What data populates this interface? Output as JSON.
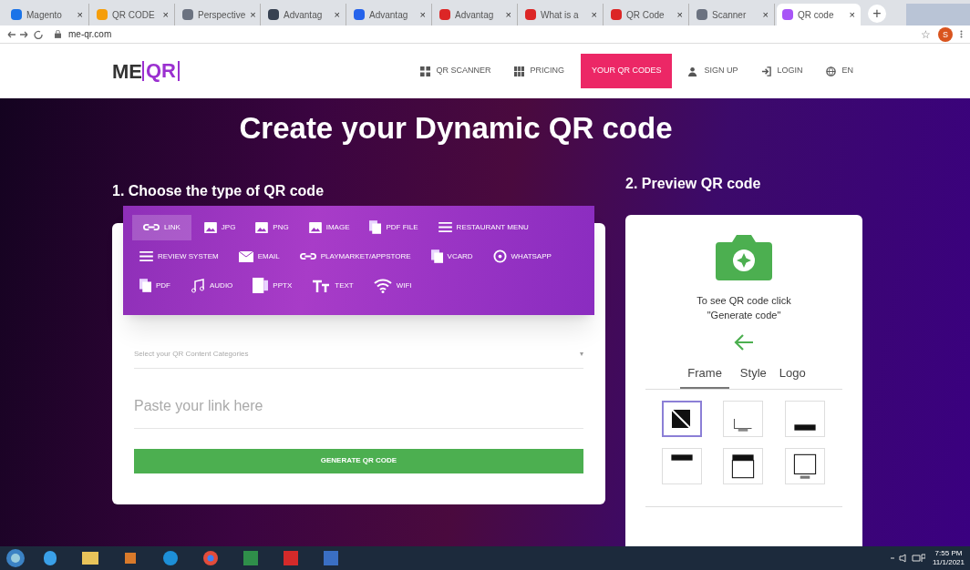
{
  "browser": {
    "tabs": [
      {
        "title": "Magento",
        "color": "#1a73e8",
        "selected": false
      },
      {
        "title": "QR CODE",
        "color": "#f59e0b",
        "selected": false
      },
      {
        "title": "Perspective",
        "color": "#6b7280",
        "selected": false
      },
      {
        "title": "Advantag",
        "color": "#374151",
        "selected": false
      },
      {
        "title": "Advantag",
        "color": "#2563eb",
        "selected": false
      },
      {
        "title": "Advantag",
        "color": "#dc2626",
        "selected": false
      },
      {
        "title": "What is a",
        "color": "#dc2626",
        "selected": false
      },
      {
        "title": "QR Code",
        "color": "#dc2626",
        "selected": false
      },
      {
        "title": "Scanner",
        "color": "#6b7280",
        "selected": false
      },
      {
        "title": "QR code",
        "color": "#a855f7",
        "selected": true
      }
    ],
    "new_tab": "+",
    "close": "×",
    "url": "me-qr.com",
    "bookmark": "☆",
    "profile": "S"
  },
  "site": {
    "logo_left": "ME",
    "logo_right": "QR",
    "nav": [
      {
        "label": "QR SCANNER",
        "kind": "grid",
        "selected": false
      },
      {
        "label": "PRICING",
        "kind": "table",
        "selected": false
      },
      {
        "label": "YOUR QR CODES",
        "kind": "plain",
        "selected": true
      },
      {
        "label": "SIGN UP",
        "kind": "user",
        "selected": false
      },
      {
        "label": "LOGIN",
        "kind": "login",
        "selected": false
      },
      {
        "label": "EN",
        "kind": "globe",
        "selected": false
      }
    ]
  },
  "title": "Create your Dynamic QR code",
  "left": {
    "heading": "1. Choose the type of QR code",
    "types": [
      {
        "label": "LINK",
        "kind": "link",
        "selected": true
      },
      {
        "label": "JPG",
        "kind": "image",
        "selected": false
      },
      {
        "label": "PNG",
        "kind": "image",
        "selected": false
      },
      {
        "label": "IMAGE",
        "kind": "image",
        "selected": false
      },
      {
        "label": "PDF FILE",
        "kind": "doc",
        "selected": false
      },
      {
        "label": "RESTAURANT MENU",
        "kind": "menu",
        "selected": false
      },
      {
        "label": "REVIEW SYSTEM",
        "kind": "menu",
        "selected": false
      },
      {
        "label": "EMAIL",
        "kind": "email",
        "selected": false
      },
      {
        "label": "PLAYMARKET/APPSTORE",
        "kind": "link",
        "selected": false
      },
      {
        "label": "VCARD",
        "kind": "doc",
        "selected": false
      },
      {
        "label": "WHATSAPP",
        "kind": "whatsapp",
        "selected": false
      },
      {
        "label": "PDF",
        "kind": "doc",
        "selected": false
      },
      {
        "label": "AUDIO",
        "kind": "audio",
        "selected": false
      },
      {
        "label": "PPTX",
        "kind": "pptx",
        "selected": false
      },
      {
        "label": "TEXT",
        "kind": "text",
        "selected": false
      },
      {
        "label": "WIFI",
        "kind": "wifi",
        "selected": false
      }
    ],
    "select_placeholder": "Select your QR Content Categories",
    "select_caret": "▾",
    "link_placeholder": "Paste your link here",
    "button": "GENERATE QR CODE"
  },
  "right": {
    "heading": "2. Preview QR code",
    "hint": "To see QR code click \"Generate code\"",
    "tabs": [
      {
        "label": "Frame",
        "selected": true
      },
      {
        "label": "Style",
        "selected": false
      },
      {
        "label": "Logo",
        "selected": false
      }
    ],
    "frames": [
      {
        "selected": true
      },
      {
        "selected": false
      },
      {
        "selected": false
      },
      {
        "selected": false
      },
      {
        "selected": false
      },
      {
        "selected": false
      }
    ]
  },
  "taskbar": {
    "time": "7:55 PM",
    "date": "11/1/2021"
  }
}
